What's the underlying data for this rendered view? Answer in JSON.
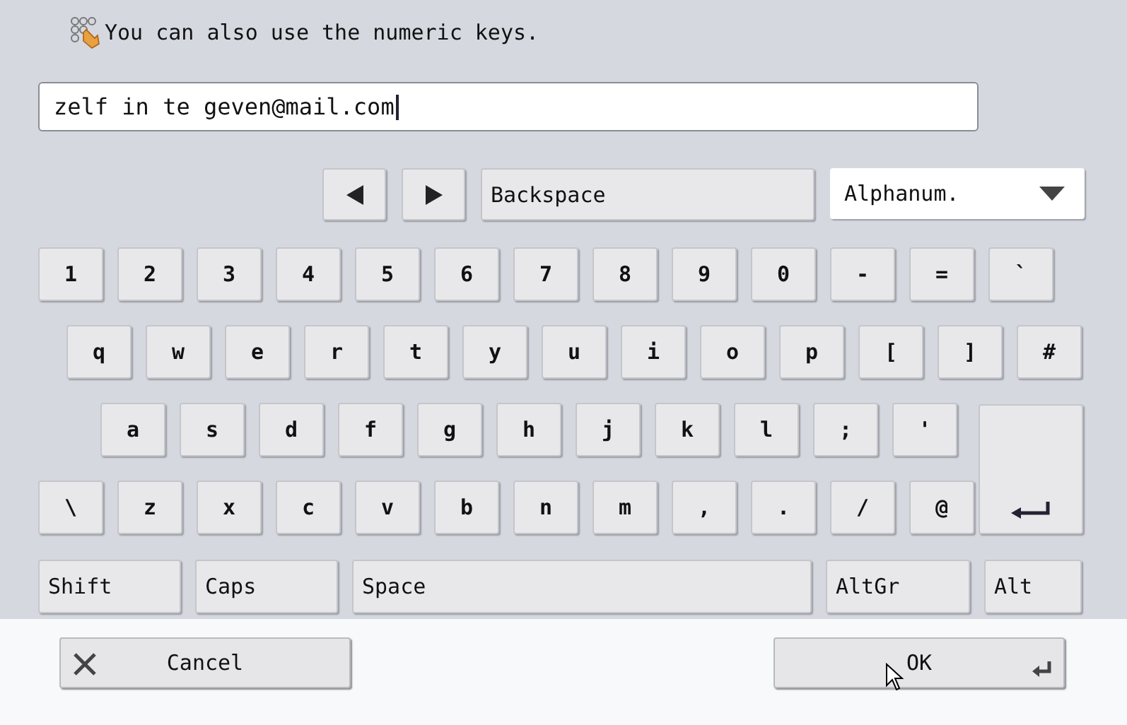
{
  "hint": {
    "text": "You can also use the numeric keys."
  },
  "input": {
    "value": "zelf in te geven@mail.com"
  },
  "toolbar": {
    "backspace": "Backspace",
    "mode": "Alphanum."
  },
  "rows": [
    [
      "1",
      "2",
      "3",
      "4",
      "5",
      "6",
      "7",
      "8",
      "9",
      "0",
      "-",
      "=",
      "`"
    ],
    [
      "q",
      "w",
      "e",
      "r",
      "t",
      "y",
      "u",
      "i",
      "o",
      "p",
      "[",
      "]",
      "#"
    ],
    [
      "a",
      "s",
      "d",
      "f",
      "g",
      "h",
      "j",
      "k",
      "l",
      ";",
      "'"
    ],
    [
      "\\",
      "z",
      "x",
      "c",
      "v",
      "b",
      "n",
      "m",
      ",",
      ".",
      "/",
      "@"
    ]
  ],
  "modifiers": [
    {
      "label": "Shift",
      "kind": "shift"
    },
    {
      "label": "Caps",
      "kind": "caps"
    },
    {
      "label": "Space",
      "kind": "space"
    },
    {
      "label": "AltGr",
      "kind": "altgr"
    },
    {
      "label": "Alt",
      "kind": "alt"
    }
  ],
  "footer": [
    {
      "label": "Cancel",
      "kind": "cancel"
    },
    {
      "label": "OK",
      "kind": "ok"
    }
  ]
}
